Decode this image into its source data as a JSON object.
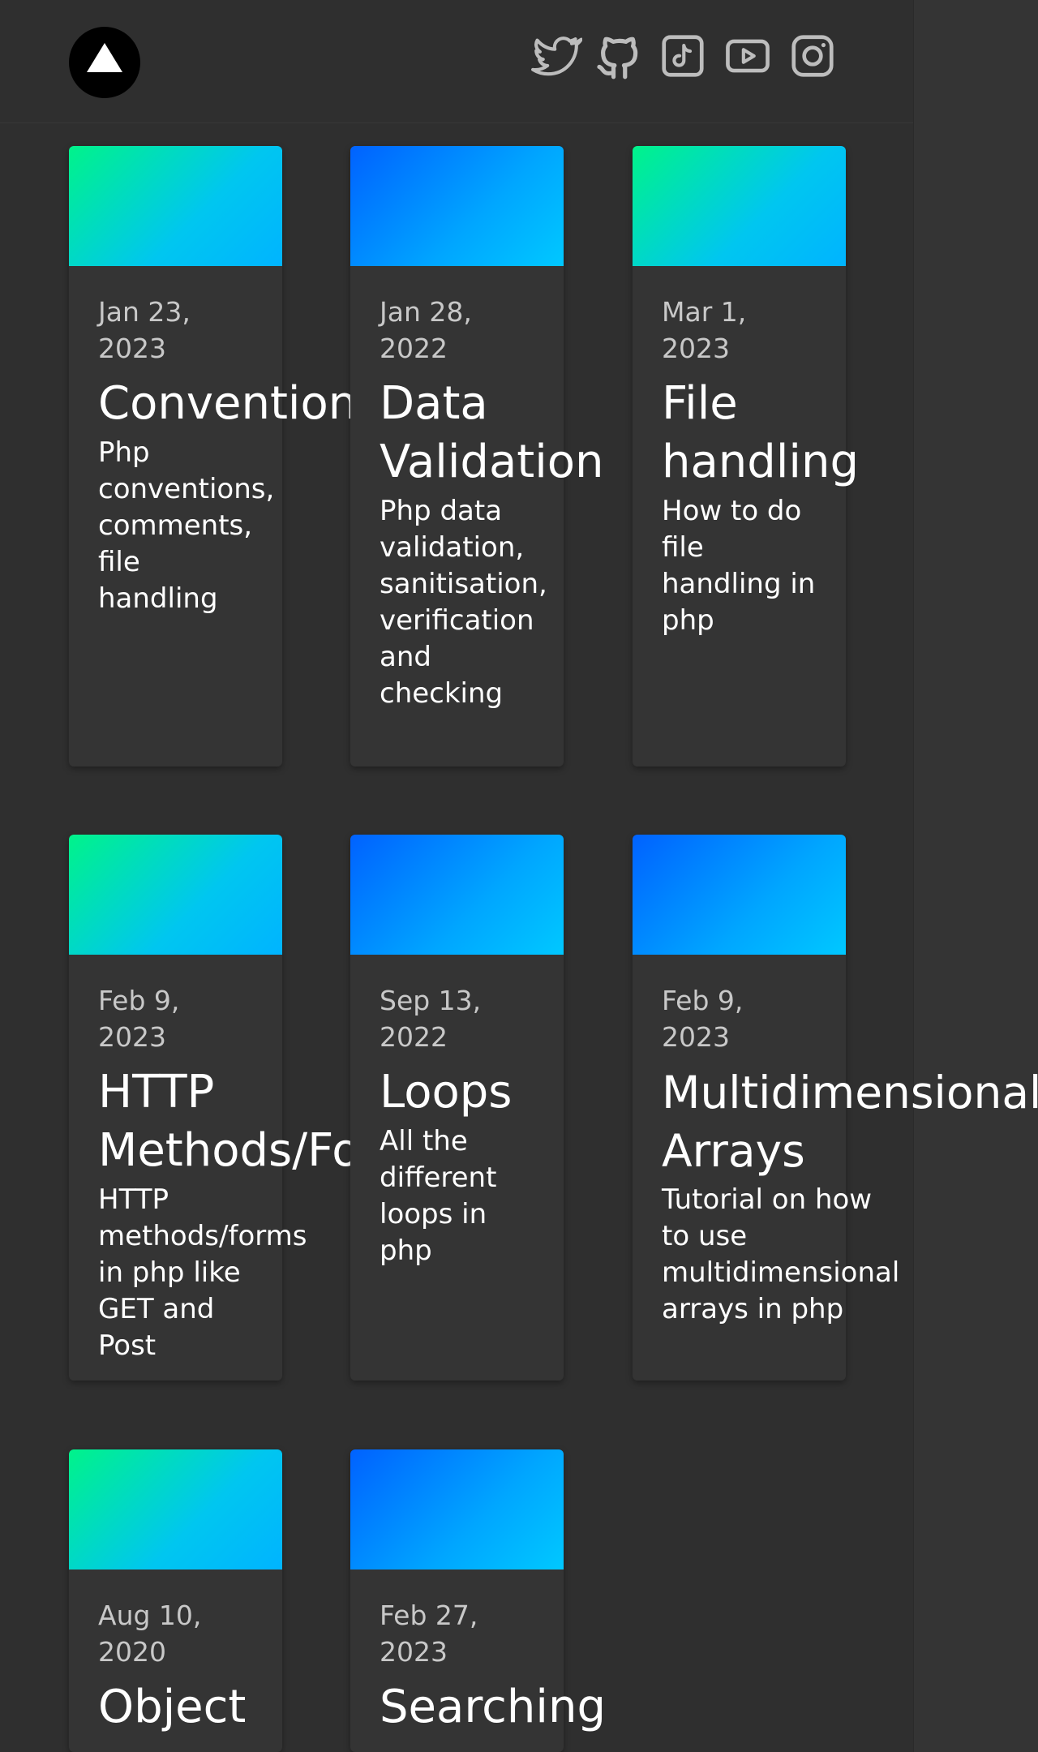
{
  "header": {
    "logo_label": "",
    "social": [
      {
        "name": "twitter-icon"
      },
      {
        "name": "github-icon"
      },
      {
        "name": "tiktok-icon"
      },
      {
        "name": "youtube-icon"
      },
      {
        "name": "instagram-icon"
      }
    ]
  },
  "cards": [
    {
      "date": "Jan 23, 2023",
      "title": "Conventions",
      "description": "Php conventions, comments, file handling"
    },
    {
      "date": "Jan 28, 2022",
      "title": "Data Validation",
      "description": "Php data validation, sanitisation, verification and checking"
    },
    {
      "date": "Mar 1, 2023",
      "title": "File handling",
      "description": "How to do file handling in php"
    },
    {
      "date": "Feb 9, 2023",
      "title": "HTTP Methods/Forms",
      "description": "HTTP methods/forms in php like GET and Post"
    },
    {
      "date": "Sep 13, 2022",
      "title": "Loops",
      "description": "All the different loops in php"
    },
    {
      "date": "Feb 9, 2023",
      "title": "Multidimensional Arrays",
      "description": "Tutorial on how to use multidimensional arrays in php"
    },
    {
      "date": "Aug 10, 2020",
      "title": "Object",
      "description": ""
    },
    {
      "date": "Feb 27, 2023",
      "title": "Searching",
      "description": ""
    }
  ],
  "colors": {
    "background": "#2f2f2f",
    "card": "#343434",
    "gradient_green_start": "#00f38a",
    "gradient_blue_start": "#0062ff"
  }
}
